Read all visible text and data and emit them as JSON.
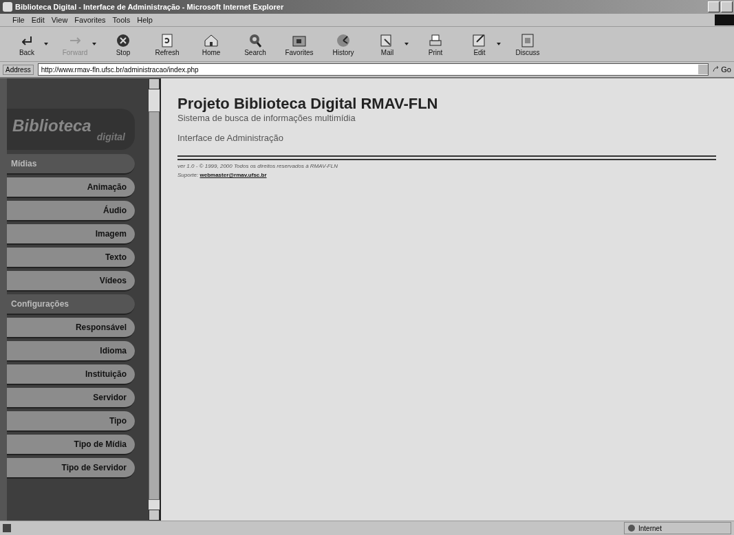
{
  "window": {
    "title": "Biblioteca Digital - Interface de Administração - Microsoft Internet Explorer"
  },
  "menu": [
    "File",
    "Edit",
    "View",
    "Favorites",
    "Tools",
    "Help"
  ],
  "toolbar": [
    {
      "label": "Back",
      "disabled": false,
      "dropdown": true
    },
    {
      "label": "Forward",
      "disabled": true,
      "dropdown": true
    },
    {
      "label": "Stop",
      "disabled": false,
      "dropdown": false
    },
    {
      "label": "Refresh",
      "disabled": false,
      "dropdown": false
    },
    {
      "label": "Home",
      "disabled": false,
      "dropdown": false
    },
    {
      "label": "Search",
      "disabled": false,
      "dropdown": false
    },
    {
      "label": "Favorites",
      "disabled": false,
      "dropdown": false
    },
    {
      "label": "History",
      "disabled": false,
      "dropdown": false
    },
    {
      "label": "Mail",
      "disabled": false,
      "dropdown": true
    },
    {
      "label": "Print",
      "disabled": false,
      "dropdown": false
    },
    {
      "label": "Edit",
      "disabled": false,
      "dropdown": true
    },
    {
      "label": "Discuss",
      "disabled": false,
      "dropdown": false
    }
  ],
  "address_bar": {
    "label": "Address",
    "value": "http://www.rmav-fln.ufsc.br/administracao/index.php",
    "go": "Go"
  },
  "sidebar": {
    "logo": {
      "title": "Biblioteca",
      "subtitle": "digital"
    },
    "items": [
      {
        "kind": "header",
        "label": "Mídias"
      },
      {
        "kind": "link",
        "label": "Animação"
      },
      {
        "kind": "link",
        "label": "Áudio"
      },
      {
        "kind": "link",
        "label": "Imagem"
      },
      {
        "kind": "link",
        "label": "Texto"
      },
      {
        "kind": "link",
        "label": "Vídeos"
      },
      {
        "kind": "header",
        "label": "Configurações"
      },
      {
        "kind": "link",
        "label": "Responsável"
      },
      {
        "kind": "link",
        "label": "Idioma"
      },
      {
        "kind": "link",
        "label": "Instituição"
      },
      {
        "kind": "link",
        "label": "Servidor"
      },
      {
        "kind": "link",
        "label": "Tipo"
      },
      {
        "kind": "link",
        "label": "Tipo de Mídia"
      },
      {
        "kind": "link",
        "label": "Tipo de Servidor"
      }
    ]
  },
  "content": {
    "title": "Projeto Biblioteca Digital RMAV-FLN",
    "subtitle": "Sistema de busca de informações multimídia",
    "section": "Interface de Administração",
    "copyright": "ver 1.0 - © 1999, 2000 Todos os direitos reservados à RMAV-FLN",
    "support_label": "Suporte:",
    "support_link": "webmaster@rmav.ufsc.br"
  },
  "status_bar": {
    "zone": "Internet"
  }
}
